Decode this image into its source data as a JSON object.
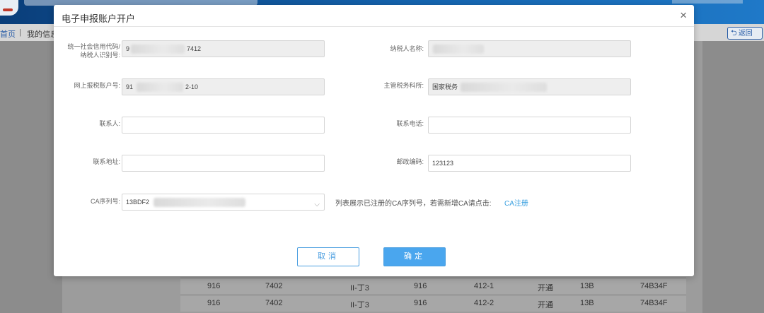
{
  "background": {
    "nav": {
      "home": "首页",
      "separator": "|",
      "messages": "我的信息"
    },
    "back_button": {
      "label": "返回",
      "icon": "back-arrow-icon"
    },
    "table_rows": [
      [
        "916",
        "7402",
        "II-丁3",
        "916",
        "412-1",
        "开通",
        "13B",
        "74B34F"
      ],
      [
        "916",
        "7402",
        "II-丁3",
        "916",
        "412-2",
        "开通",
        "13B",
        "74B34F"
      ]
    ]
  },
  "modal": {
    "title": "电子申报账户开户",
    "close_icon": "close-icon",
    "fields": {
      "credit_code": {
        "label_line1": "统一社会信用代码/",
        "label_line2": "纳税人识别号:",
        "value_prefix": "9",
        "value_suffix": "7412"
      },
      "taxpayer_name": {
        "label": "纳税人名称:",
        "value": ""
      },
      "online_account": {
        "label": "网上报税账户号:",
        "value_prefix": "91",
        "value_suffix": "2-10"
      },
      "tax_office": {
        "label": "主管税务科所:",
        "value_prefix": "国家税务"
      },
      "contact_person": {
        "label": "联系人:",
        "value": ""
      },
      "contact_phone": {
        "label": "联系电话:",
        "value": ""
      },
      "contact_address": {
        "label": "联系地址:",
        "value": ""
      },
      "postal_code": {
        "label": "邮政编码:",
        "value": "123123"
      },
      "ca_serial": {
        "label": "CA序列号:",
        "value_prefix": "13BDF2",
        "caret_icon": "chevron-down-icon"
      }
    },
    "ca_hint": "列表展示已注册的CA序列号，若需新增CA请点击:",
    "ca_link": "CA注册",
    "buttons": {
      "cancel": "取消",
      "ok": "确定"
    }
  },
  "colors": {
    "accent": "#4aa6ee",
    "link": "#3aa0e0",
    "header_blue": "#1565b0"
  }
}
